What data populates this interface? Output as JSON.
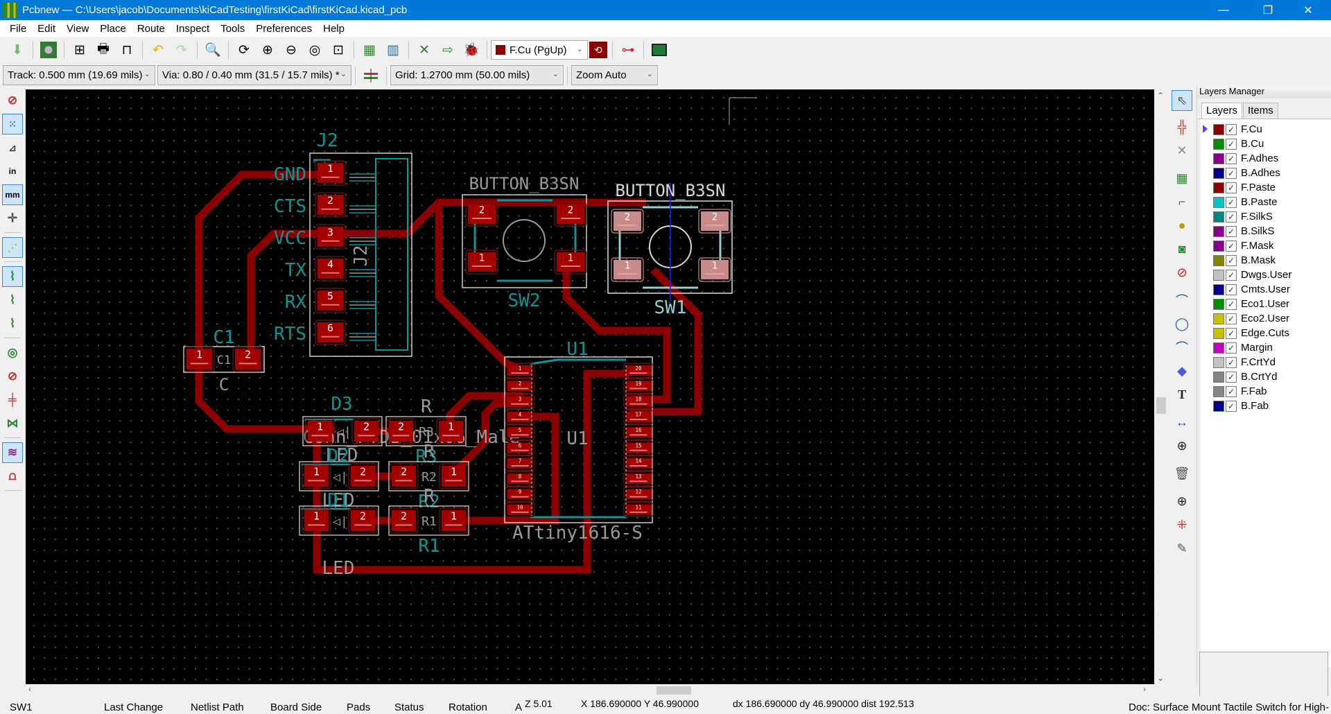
{
  "window": {
    "title": "Pcbnew — C:\\Users\\jacob\\Documents\\kiCadTesting\\firstKiCad\\firstKiCad.kicad_pcb",
    "controls": {
      "minimize": "—",
      "maximize": "❐",
      "close": "✕"
    }
  },
  "menu": [
    "File",
    "Edit",
    "View",
    "Place",
    "Route",
    "Inspect",
    "Tools",
    "Preferences",
    "Help"
  ],
  "toolbar_top": {
    "icons": [
      "save-icon",
      "board-setup-icon",
      "page-settings-icon",
      "print-icon",
      "plot-icon",
      "undo-icon",
      "redo-icon",
      "find-icon",
      "redraw-icon",
      "zoom-in-icon",
      "zoom-out-icon",
      "zoom-fit-icon",
      "zoom-selection-icon",
      "footprint-editor-icon",
      "footprint-browser-icon",
      "load-netlist-icon",
      "update-pcb-icon",
      "drc-icon",
      "layer-pair-icon",
      "schematic-icon",
      "scripting-console-icon"
    ],
    "layer_select": "F.Cu (PgUp)",
    "layer_color": "#8b0000"
  },
  "toolbar_aux": {
    "track": "Track: 0.500 mm (19.69 mils)",
    "via": "Via: 0.80 / 0.40 mm (31.5 / 15.7 mils) *",
    "grid": "Grid: 1.2700 mm (50.00 mils)",
    "zoom": "Zoom Auto"
  },
  "left_tools": {
    "unit_in": "in",
    "unit_mm": "mm"
  },
  "layers_manager": {
    "title": "Layers Manager",
    "tabs": [
      "Layers",
      "Items"
    ],
    "active_tab": "Layers",
    "layers": [
      {
        "name": "F.Cu",
        "color": "#8b0000",
        "checked": true,
        "current": true
      },
      {
        "name": "B.Cu",
        "color": "#008b00",
        "checked": true
      },
      {
        "name": "F.Adhes",
        "color": "#84008b",
        "checked": true
      },
      {
        "name": "B.Adhes",
        "color": "#00008b",
        "checked": true
      },
      {
        "name": "F.Paste",
        "color": "#8b0000",
        "checked": true
      },
      {
        "name": "B.Paste",
        "color": "#00c2c2",
        "checked": true
      },
      {
        "name": "F.SilkS",
        "color": "#008484",
        "checked": true
      },
      {
        "name": "B.SilkS",
        "color": "#84008b",
        "checked": true
      },
      {
        "name": "F.Mask",
        "color": "#84008b",
        "checked": true
      },
      {
        "name": "B.Mask",
        "color": "#848400",
        "checked": true
      },
      {
        "name": "Dwgs.User",
        "color": "#c2c2c2",
        "checked": true
      },
      {
        "name": "Cmts.User",
        "color": "#00008b",
        "checked": true
      },
      {
        "name": "Eco1.User",
        "color": "#008b00",
        "checked": true
      },
      {
        "name": "Eco2.User",
        "color": "#c2c200",
        "checked": true
      },
      {
        "name": "Edge.Cuts",
        "color": "#c2c200",
        "checked": true
      },
      {
        "name": "Margin",
        "color": "#c200c2",
        "checked": true
      },
      {
        "name": "F.CrtYd",
        "color": "#c2c2c2",
        "checked": true
      },
      {
        "name": "B.CrtYd",
        "color": "#848484",
        "checked": true
      },
      {
        "name": "F.Fab",
        "color": "#848484",
        "checked": true
      },
      {
        "name": "B.Fab",
        "color": "#00008b",
        "checked": true
      }
    ]
  },
  "pcb": {
    "colors": {
      "copper": "#8b0000",
      "pad": "#a50000",
      "pad_hl": "#c98a8a",
      "silk": "#0e9494",
      "fab": "#9a9a9a",
      "courtyard": "#d0d0d0"
    },
    "footprints": {
      "J2": {
        "ref": "J2",
        "value": "Conn_FTDI_01x06_Male",
        "pin_labels": [
          "GND",
          "CTS",
          "VCC",
          "TX",
          "RX",
          "RTS"
        ],
        "pads": [
          "1",
          "2",
          "3",
          "4",
          "5",
          "6"
        ],
        "fab_ref": "J2"
      },
      "SW2": {
        "ref": "SW2",
        "value": "BUTTON_B3SN",
        "pads": [
          "2",
          "2",
          "1",
          "1"
        ]
      },
      "SW1": {
        "ref": "SW1",
        "value": "BUTTON_B3SN",
        "pads": [
          "2",
          "2",
          "1",
          "1"
        ]
      },
      "C1": {
        "ref": "C1",
        "value": "C",
        "fab_ref": "C1",
        "pads": [
          "1",
          "2"
        ]
      },
      "D3": {
        "ref": "D3",
        "value": "LED",
        "pads": [
          "1",
          "2"
        ]
      },
      "D2": {
        "ref": "D2",
        "value": "LED",
        "pads": [
          "1",
          "2"
        ]
      },
      "D1": {
        "ref": "D1",
        "value": "LED",
        "pads": [
          "1",
          "2"
        ]
      },
      "R3": {
        "ref": "R3",
        "value": "R",
        "fab_ref": "R3",
        "pads": [
          "2",
          "1"
        ]
      },
      "R2": {
        "ref": "R2",
        "value": "R",
        "fab_ref": "R2",
        "pads": [
          "2",
          "1"
        ]
      },
      "R1": {
        "ref": "R1",
        "value": "R",
        "fab_ref": "R1",
        "pads": [
          "2",
          "1"
        ]
      },
      "U1": {
        "ref": "U1",
        "value": "ATtiny1616-S",
        "fab_ref": "U1",
        "pins_left": [
          "1",
          "2",
          "3",
          "4",
          "5",
          "6",
          "7",
          "8",
          "9",
          "10"
        ],
        "pins_right": [
          "20",
          "19",
          "18",
          "17",
          "16",
          "15",
          "14",
          "13",
          "12",
          "11"
        ]
      }
    }
  },
  "status": {
    "selected": "SW1",
    "last_change": "Last Change",
    "netlist_path": "Netlist Path",
    "board_side": "Board Side",
    "pads": "Pads",
    "status": "Status",
    "rotation": "Rotation",
    "a": "A",
    "zoom": "Z 5.01",
    "xy": "X 186.690000  Y 46.990000",
    "dxy": "dx 186.690000  dy 46.990000  dist 192.513",
    "doc": "Doc: Surface Mount Tactile Switch for High-"
  }
}
